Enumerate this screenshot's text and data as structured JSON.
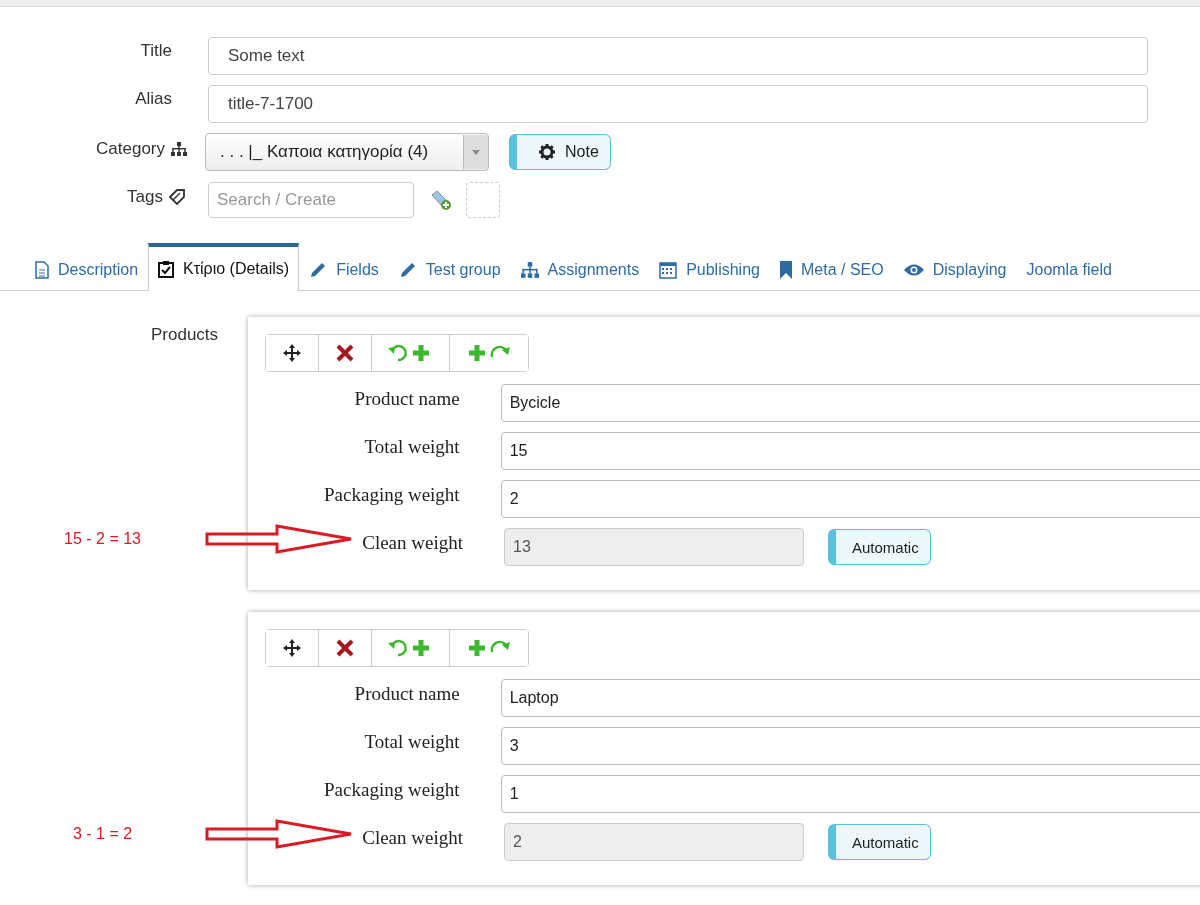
{
  "form": {
    "title": {
      "label": "Title",
      "value": "Some text"
    },
    "alias": {
      "label": "Alias",
      "value": "title-7-1700"
    },
    "category": {
      "label": "Category",
      "value": ". . . |_ Καποια κατηγορία (4)",
      "note_button": "Note"
    },
    "tags": {
      "label": "Tags",
      "placeholder": "Search / Create"
    }
  },
  "tabs": [
    {
      "label": "Description",
      "kind": "document",
      "selected": false
    },
    {
      "label": "Κτίριο (Details)",
      "kind": "clipboard",
      "selected": true
    },
    {
      "label": "Fields",
      "kind": "pencil",
      "selected": false
    },
    {
      "label": "Test group",
      "kind": "pencil",
      "selected": false
    },
    {
      "label": "Assignments",
      "kind": "sitemap",
      "selected": false
    },
    {
      "label": "Publishing",
      "kind": "calendar",
      "selected": false
    },
    {
      "label": "Meta / SEO",
      "kind": "bookmark",
      "selected": false
    },
    {
      "label": "Displaying",
      "kind": "eye",
      "selected": false
    },
    {
      "label": "Joomla field",
      "kind": "plain",
      "selected": false
    }
  ],
  "products": {
    "label": "Products",
    "items": [
      {
        "annotation": "15 - 2 = 13",
        "fields": [
          {
            "kind": "text",
            "label": "Product name",
            "value": "Bycicle"
          },
          {
            "kind": "text",
            "label": "Total weight",
            "value": "15"
          },
          {
            "kind": "text",
            "label": "Packaging weight",
            "value": "2"
          },
          {
            "kind": "computed",
            "label": "Clean weight",
            "value": "13",
            "badge": "Automatic"
          }
        ]
      },
      {
        "annotation": "3 - 1 = 2",
        "fields": [
          {
            "kind": "text",
            "label": "Product name",
            "value": "Laptop"
          },
          {
            "kind": "text",
            "label": "Total weight",
            "value": "3"
          },
          {
            "kind": "text",
            "label": "Packaging weight",
            "value": "1"
          },
          {
            "kind": "computed",
            "label": "Clean weight",
            "value": "2",
            "badge": "Automatic"
          }
        ]
      }
    ]
  }
}
